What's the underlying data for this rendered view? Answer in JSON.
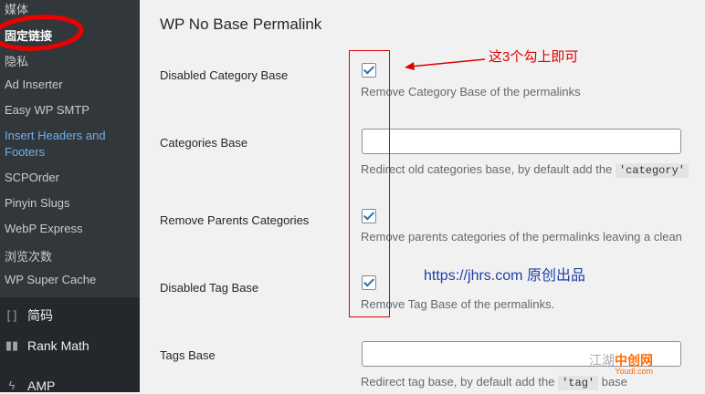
{
  "sidebar": {
    "submenu": [
      "媒体",
      "固定链接",
      "隐私",
      "Ad Inserter",
      "Easy WP SMTP",
      "Insert Headers and Footers",
      "SCPOrder",
      "Pinyin Slugs",
      "WebP Express",
      "浏览次数",
      "WP Super Cache"
    ],
    "menu": [
      {
        "icon": "[ ]",
        "label": "简码"
      },
      {
        "icon": "▮▮",
        "label": "Rank Math"
      },
      {
        "icon": "ϟ",
        "label": "AMP"
      }
    ]
  },
  "main": {
    "title": "WP No Base Permalink",
    "rows": [
      {
        "label": "Disabled Category Base",
        "desc": "Remove Category Base of the permalinks"
      },
      {
        "label": "Categories Base",
        "desc": "Redirect old categories base, by default add the",
        "code": "'category'"
      },
      {
        "label": "Remove Parents Categories",
        "desc": "Remove parents categories of the permalinks leaving a clean"
      },
      {
        "label": "Disabled Tag Base",
        "desc": "Remove Tag Base of the permalinks."
      },
      {
        "label": "Tags Base",
        "desc": "Redirect tag base, by default add the",
        "code": "'tag'",
        "desc_tail": "base"
      }
    ]
  },
  "annotation": {
    "text": "这3个勾上即可"
  },
  "watermark": {
    "url": "https://jhrs.com",
    "suffix": "原创出品"
  },
  "logo": {
    "text": "江湖",
    "brand": "中创网",
    "sub": "Youdl.com"
  },
  "colors": {
    "sidebar": "#23282d",
    "submenu": "#32373c",
    "accent": "#2271b1",
    "annotation": "#dd0000"
  }
}
